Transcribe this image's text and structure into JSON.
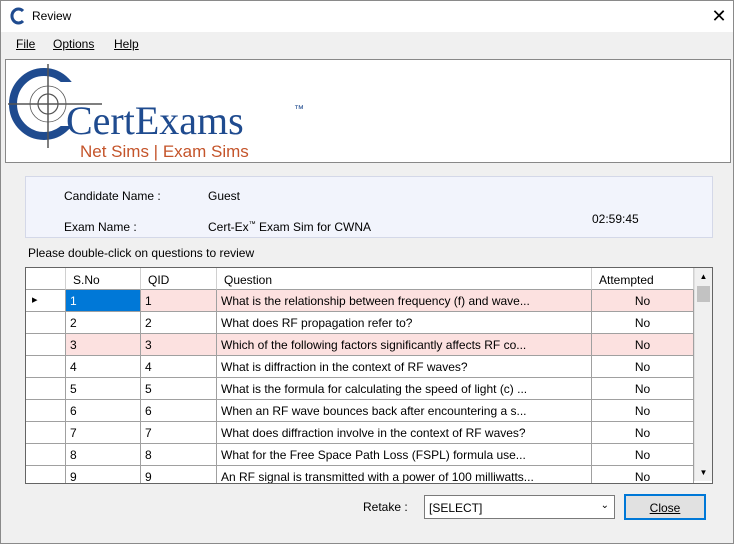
{
  "window": {
    "title": "Review"
  },
  "menu": {
    "file": "File",
    "options": "Options",
    "help": "Help"
  },
  "brand": {
    "logo_text": "CertExams",
    "trademark": "™",
    "tagline": "Net Sims | Exam Sims",
    "colors": {
      "blue": "#1f4b8f",
      "orange": "#c4542a"
    }
  },
  "info": {
    "candidate_label": "Candidate Name :",
    "candidate_value": "Guest",
    "exam_label": "Exam Name :",
    "exam_value_pre": "Cert-Ex",
    "exam_value_tm": "™",
    "exam_value_post": " Exam Sim for CWNA",
    "timer": "02:59:45"
  },
  "instruction": "Please double-click on questions to review",
  "table": {
    "headers": {
      "sno": "S.No",
      "qid": "QID",
      "question": "Question",
      "attempted": "Attempted"
    },
    "rows": [
      {
        "sno": "1",
        "qid": "1",
        "question": "What is the relationship between frequency (f) and wave...",
        "attempted": "No"
      },
      {
        "sno": "2",
        "qid": "2",
        "question": "What does RF propagation refer to?",
        "attempted": "No"
      },
      {
        "sno": "3",
        "qid": "3",
        "question": "Which of the following factors significantly affects RF co...",
        "attempted": "No"
      },
      {
        "sno": "4",
        "qid": "4",
        "question": "What is diffraction in the context of RF waves?",
        "attempted": "No"
      },
      {
        "sno": "5",
        "qid": "5",
        "question": "What is the formula for calculating the speed of light (c) ...",
        "attempted": "No"
      },
      {
        "sno": "6",
        "qid": "6",
        "question": "When an RF wave bounces back after encountering a s...",
        "attempted": "No"
      },
      {
        "sno": "7",
        "qid": "7",
        "question": "What does diffraction involve in the context of RF waves?",
        "attempted": "No"
      },
      {
        "sno": "8",
        "qid": "8",
        "question": "What for the Free Space Path Loss (FSPL) formula use...",
        "attempted": "No"
      },
      {
        "sno": "9",
        "qid": "9",
        "question": "An RF signal is transmitted with a power of 100 milliwatts...",
        "attempted": "No"
      }
    ]
  },
  "bottom": {
    "retake_label": "Retake :",
    "retake_value": "[SELECT]",
    "close_label": "Close"
  }
}
